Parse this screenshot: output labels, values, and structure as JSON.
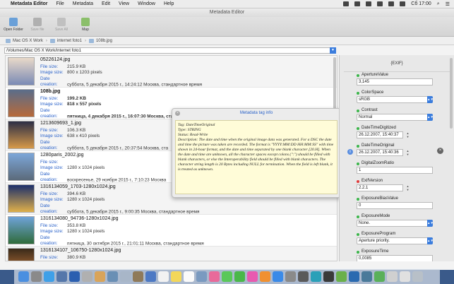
{
  "menubar": {
    "apple": "",
    "items": [
      "Metadata Editor",
      "File",
      "Metadata",
      "Edit",
      "View",
      "Window",
      "Help"
    ],
    "clock": "Сб 17:00"
  },
  "window": {
    "title": "Metadata Editor"
  },
  "toolbar": {
    "open_folder": "Open Folder",
    "save_file": "Save file",
    "save_all": "Save All",
    "map": "Map"
  },
  "breadcrumb": [
    "Mac OS X Work",
    "internet foto1",
    "108b.jpg"
  ],
  "path": "/Volumes/Mac OS X Work/internet foto1",
  "labels": {
    "file_size": "File size:",
    "image_size": "Image size:",
    "date_creation": "Date creation:"
  },
  "files": [
    {
      "name": "05226124.jpg",
      "size": "215.9 KB",
      "dims": "800 x 1203 pixels",
      "date": "суббота, 5 декабря 2015 г., 14:24:12 Москва, стандартное время"
    },
    {
      "name": "108b.jpg",
      "size": "199.2 KB",
      "dims": "818 x 557 pixels",
      "date": "пятница, 4 декабря 2015 г., 16:07:30 Москва, ста"
    },
    {
      "name": "1213609693_1.jpg",
      "size": "106.3 KB",
      "dims": "638 x 410 pixels",
      "date": "суббота, 5 декабря 2015 г., 20:37:54 Москва, ста"
    },
    {
      "name": "1280paris_2002.jpg",
      "size": "",
      "dims": "1280 x 1024 pixels",
      "date": "воскресенье, 29 ноября 2015 г., 7:10:23 Москва"
    },
    {
      "name": "1316134059_1703-1280x1024.jpg",
      "size": "394.6 KB",
      "dims": "1280 x 1024 pixels",
      "date": "суббота, 5 декабря 2015 г., 9:00:35 Москва, стандартное время"
    },
    {
      "name": "1316134080_94736-1280x1024.jpg",
      "size": "353.8 KB",
      "dims": "1280 x 1024 pixels",
      "date": "пятница, 30 октября 2015 г., 21:01:11 Москва, стандартное время"
    },
    {
      "name": "1316134107_106750-1280x1024.jpg",
      "size": "380.9 KB",
      "dims": "",
      "date": ""
    }
  ],
  "tooltip": {
    "title": "Metadata tag info",
    "close": "×",
    "lines": [
      "Tag: DateTimeOriginal",
      "Type: STRING",
      "Status: Read-Write",
      "Description: The date and time when the original image data was generated. For a DSC the date and time the picture was taken are recorded. The format is \"YYYY:MM:DD HH:MM:SS\" with time shown in 24-hour format, and the date and time separated by one blank character [20.H]. When the date and time are unknown, all the character spaces except colons (\":\") should be filled with blank characters, or else the Interoperability field should be filled with blank characters. The character string length is 20 Bytes including NULL for termination. When the field is left blank, it is treated as unknown."
    ]
  },
  "panel": {
    "header": "{EXIF}",
    "fields": [
      {
        "label": "ApertureValue",
        "value": "3,145",
        "dot": "g",
        "kind": "text"
      },
      {
        "label": "ColorSpace",
        "value": "sRGB",
        "dot": "g",
        "kind": "select"
      },
      {
        "label": "Contrast",
        "value": "Normal",
        "dot": "g",
        "kind": "select"
      },
      {
        "label": "DateTimeDigitized",
        "value": "26.12.2007, 15:40:37",
        "dot": "g",
        "kind": "date"
      },
      {
        "label": "DateTimeOriginal",
        "value": "26.12.2007, 15:40:36",
        "dot": "g",
        "kind": "date"
      },
      {
        "label": "DigitalZoomRatio",
        "value": "1",
        "dot": "g",
        "kind": "text"
      },
      {
        "label": "ExifVersion",
        "value": "2.2.1",
        "dot": "r",
        "kind": "short"
      },
      {
        "label": "ExposureBiasValue",
        "value": "0",
        "dot": "g",
        "kind": "text"
      },
      {
        "label": "ExposureMode",
        "value": "None.",
        "dot": "g",
        "kind": "select"
      },
      {
        "label": "ExposureProgram",
        "value": "Aperture priority.",
        "dot": "g",
        "kind": "select"
      },
      {
        "label": "ExposureTime",
        "value": "0,0085",
        "dot": "g",
        "kind": "text"
      }
    ]
  },
  "colors": {
    "accent": "#3b7ddd",
    "label_blue": "#2a62c9",
    "tooltip_bg": "#fffcd8"
  }
}
